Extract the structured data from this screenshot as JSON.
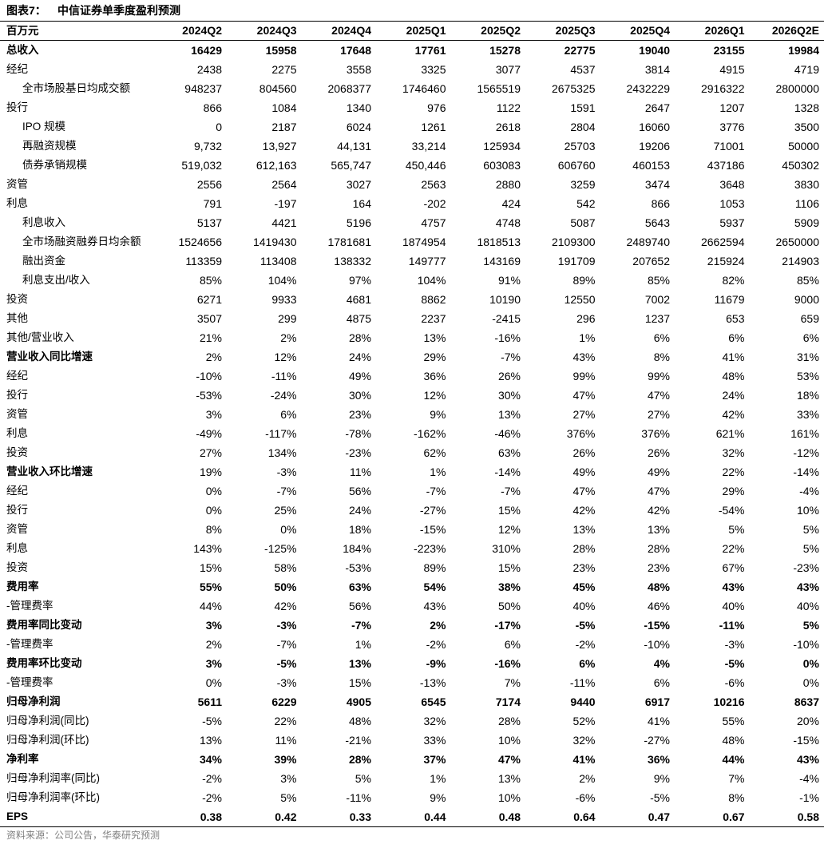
{
  "figure": {
    "label": "图表7：",
    "title": "中信证券单季度盈利预测"
  },
  "table": {
    "unit": "百万元",
    "columns": [
      "2024Q2",
      "2024Q3",
      "2024Q4",
      "2025Q1",
      "2025Q2",
      "2025Q3",
      "2025Q4",
      "2026Q1",
      "2026Q2E"
    ],
    "rows": [
      {
        "label": "总收入",
        "values": [
          "16429",
          "15958",
          "17648",
          "17761",
          "15278",
          "22775",
          "19040",
          "23155",
          "19984"
        ]
      },
      {
        "label": "经纪",
        "values": [
          "2438",
          "2275",
          "3558",
          "3325",
          "3077",
          "4537",
          "3814",
          "4915",
          "4719"
        ]
      },
      {
        "label": "全市场股基日均成交额",
        "values": [
          "948237",
          "804560",
          "2068377",
          "1746460",
          "1565519",
          "2675325",
          "2432229",
          "2916322",
          "2800000"
        ]
      },
      {
        "label": "投行",
        "values": [
          "866",
          "1084",
          "1340",
          "976",
          "1122",
          "1591",
          "2647",
          "1207",
          "1328"
        ]
      },
      {
        "label": "IPO 规模",
        "values": [
          "0",
          "2187",
          "6024",
          "1261",
          "2618",
          "2804",
          "16060",
          "3776",
          "3500"
        ]
      },
      {
        "label": "再融资规模",
        "values": [
          "9,732",
          "13,927",
          "44,131",
          "33,214",
          "125934",
          "25703",
          "19206",
          "71001",
          "50000"
        ]
      },
      {
        "label": "债券承销规模",
        "values": [
          "519,032",
          "612,163",
          "565,747",
          "450,446",
          "603083",
          "606760",
          "460153",
          "437186",
          "450302"
        ]
      },
      {
        "label": "资管",
        "values": [
          "2556",
          "2564",
          "3027",
          "2563",
          "2880",
          "3259",
          "3474",
          "3648",
          "3830"
        ]
      },
      {
        "label": "利息",
        "values": [
          "791",
          "-197",
          "164",
          "-202",
          "424",
          "542",
          "866",
          "1053",
          "1106"
        ]
      },
      {
        "label": "利息收入",
        "values": [
          "5137",
          "4421",
          "5196",
          "4757",
          "4748",
          "5087",
          "5643",
          "5937",
          "5909"
        ]
      },
      {
        "label": "全市场融资融券日均余额",
        "values": [
          "1524656",
          "1419430",
          "1781681",
          "1874954",
          "1818513",
          "2109300",
          "2489740",
          "2662594",
          "2650000"
        ]
      },
      {
        "label": "融出资金",
        "values": [
          "113359",
          "113408",
          "138332",
          "149777",
          "143169",
          "191709",
          "207652",
          "215924",
          "214903"
        ]
      },
      {
        "label": "利息支出/收入",
        "values": [
          "85%",
          "104%",
          "97%",
          "104%",
          "91%",
          "89%",
          "85%",
          "82%",
          "85%"
        ]
      },
      {
        "label": "投资",
        "values": [
          "6271",
          "9933",
          "4681",
          "8862",
          "10190",
          "12550",
          "7002",
          "11679",
          "9000"
        ]
      },
      {
        "label": "其他",
        "values": [
          "3507",
          "299",
          "4875",
          "2237",
          "-2415",
          "296",
          "1237",
          "653",
          "659"
        ]
      },
      {
        "label": "其他/营业收入",
        "values": [
          "21%",
          "2%",
          "28%",
          "13%",
          "-16%",
          "1%",
          "6%",
          "6%",
          "6%"
        ]
      },
      {
        "label": "营业收入同比增速",
        "values": [
          "2%",
          "12%",
          "24%",
          "29%",
          "-7%",
          "43%",
          "8%",
          "41%",
          "31%"
        ]
      },
      {
        "label": "经纪",
        "values": [
          "-10%",
          "-11%",
          "49%",
          "36%",
          "26%",
          "99%",
          "99%",
          "48%",
          "53%"
        ]
      },
      {
        "label": "投行",
        "values": [
          "-53%",
          "-24%",
          "30%",
          "12%",
          "30%",
          "47%",
          "47%",
          "24%",
          "18%"
        ]
      },
      {
        "label": "资管",
        "values": [
          "3%",
          "6%",
          "23%",
          "9%",
          "13%",
          "27%",
          "27%",
          "42%",
          "33%"
        ]
      },
      {
        "label": "利息",
        "values": [
          "-49%",
          "-117%",
          "-78%",
          "-162%",
          "-46%",
          "376%",
          "376%",
          "621%",
          "161%"
        ]
      },
      {
        "label": "投资",
        "values": [
          "27%",
          "134%",
          "-23%",
          "62%",
          "63%",
          "26%",
          "26%",
          "32%",
          "-12%"
        ]
      },
      {
        "label": "营业收入环比增速",
        "values": [
          "19%",
          "-3%",
          "11%",
          "1%",
          "-14%",
          "49%",
          "49%",
          "22%",
          "-14%"
        ]
      },
      {
        "label": "经纪",
        "values": [
          "0%",
          "-7%",
          "56%",
          "-7%",
          "-7%",
          "47%",
          "47%",
          "29%",
          "-4%"
        ]
      },
      {
        "label": "投行",
        "values": [
          "0%",
          "25%",
          "24%",
          "-27%",
          "15%",
          "42%",
          "42%",
          "-54%",
          "10%"
        ]
      },
      {
        "label": "资管",
        "values": [
          "8%",
          "0%",
          "18%",
          "-15%",
          "12%",
          "13%",
          "13%",
          "5%",
          "5%"
        ]
      },
      {
        "label": "利息",
        "values": [
          "143%",
          "-125%",
          "184%",
          "-223%",
          "310%",
          "28%",
          "28%",
          "22%",
          "5%"
        ]
      },
      {
        "label": "投资",
        "values": [
          "15%",
          "58%",
          "-53%",
          "89%",
          "15%",
          "23%",
          "23%",
          "67%",
          "-23%"
        ]
      },
      {
        "label": "费用率",
        "values": [
          "55%",
          "50%",
          "63%",
          "54%",
          "38%",
          "45%",
          "48%",
          "43%",
          "43%"
        ]
      },
      {
        "label": "-管理费率",
        "values": [
          "44%",
          "42%",
          "56%",
          "43%",
          "50%",
          "40%",
          "46%",
          "40%",
          "40%"
        ]
      },
      {
        "label": "费用率同比变动",
        "values": [
          "3%",
          "-3%",
          "-7%",
          "2%",
          "-17%",
          "-5%",
          "-15%",
          "-11%",
          "5%"
        ]
      },
      {
        "label": "-管理费率",
        "values": [
          "2%",
          "-7%",
          "1%",
          "-2%",
          "6%",
          "-2%",
          "-10%",
          "-3%",
          "-10%"
        ]
      },
      {
        "label": "费用率环比变动",
        "values": [
          "3%",
          "-5%",
          "13%",
          "-9%",
          "-16%",
          "6%",
          "4%",
          "-5%",
          "0%"
        ]
      },
      {
        "label": "-管理费率",
        "values": [
          "0%",
          "-3%",
          "15%",
          "-13%",
          "7%",
          "-11%",
          "6%",
          "-6%",
          "0%"
        ]
      },
      {
        "label": "归母净利润",
        "values": [
          "5611",
          "6229",
          "4905",
          "6545",
          "7174",
          "9440",
          "6917",
          "10216",
          "8637"
        ]
      },
      {
        "label": "归母净利润(同比)",
        "values": [
          "-5%",
          "22%",
          "48%",
          "32%",
          "28%",
          "52%",
          "41%",
          "55%",
          "20%"
        ]
      },
      {
        "label": "归母净利润(环比)",
        "values": [
          "13%",
          "11%",
          "-21%",
          "33%",
          "10%",
          "32%",
          "-27%",
          "48%",
          "-15%"
        ]
      },
      {
        "label": "净利率",
        "values": [
          "34%",
          "39%",
          "28%",
          "37%",
          "47%",
          "41%",
          "36%",
          "44%",
          "43%"
        ]
      },
      {
        "label": "归母净利润率(同比)",
        "values": [
          "-2%",
          "3%",
          "5%",
          "1%",
          "13%",
          "2%",
          "9%",
          "7%",
          "-4%"
        ]
      },
      {
        "label": "归母净利润率(环比)",
        "values": [
          "-2%",
          "5%",
          "-11%",
          "9%",
          "10%",
          "-6%",
          "-5%",
          "8%",
          "-1%"
        ]
      },
      {
        "label": "EPS",
        "values": [
          "0.38",
          "0.42",
          "0.33",
          "0.44",
          "0.48",
          "0.64",
          "0.47",
          "0.67",
          "0.58"
        ]
      }
    ]
  },
  "source": "资料来源：公司公告，华泰研究预测"
}
